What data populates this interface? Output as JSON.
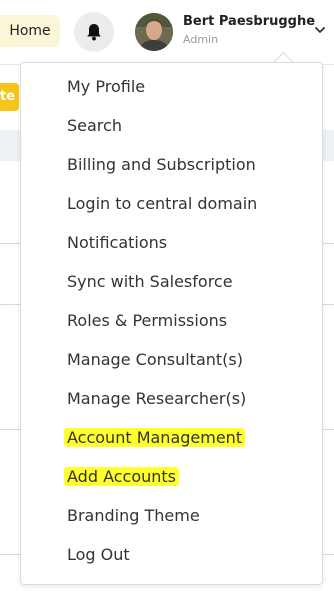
{
  "header": {
    "home_label": "Home",
    "bell_icon": "bell-icon",
    "user": {
      "name": "Bert Paesbrugghe",
      "role": "Admin"
    },
    "chevron_icon": "chevron-down-icon"
  },
  "background": {
    "button_fragment": "te",
    "accent_color": "#f5c518"
  },
  "menu": {
    "items": [
      {
        "label": "My Profile",
        "highlighted": false
      },
      {
        "label": "Search",
        "highlighted": false
      },
      {
        "label": "Billing and Subscription",
        "highlighted": false
      },
      {
        "label": "Login to central domain",
        "highlighted": false
      },
      {
        "label": "Notifications",
        "highlighted": false
      },
      {
        "label": "Sync with Salesforce",
        "highlighted": false
      },
      {
        "label": "Roles & Permissions",
        "highlighted": false
      },
      {
        "label": "Manage Consultant(s)",
        "highlighted": false
      },
      {
        "label": "Manage Researcher(s)",
        "highlighted": false
      },
      {
        "label": "Account Management",
        "highlighted": true
      },
      {
        "label": "Add Accounts",
        "highlighted": true
      },
      {
        "label": "Branding Theme",
        "highlighted": false
      },
      {
        "label": "Log Out",
        "highlighted": false
      }
    ],
    "highlight_color": "#ffff2e"
  }
}
